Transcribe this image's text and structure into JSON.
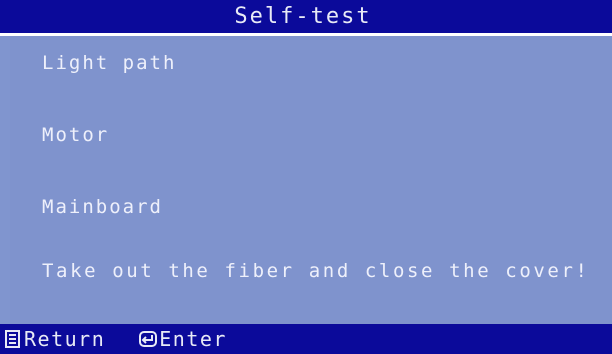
{
  "header": {
    "title": "Self-test"
  },
  "tests": [
    {
      "label": "Light path"
    },
    {
      "label": "Motor"
    },
    {
      "label": "Mainboard"
    }
  ],
  "message": "Take out the fiber and close the cover!",
  "footer": {
    "return": {
      "icon": "return-icon",
      "label": "Return"
    },
    "enter": {
      "icon": "enter-icon",
      "label": "Enter"
    }
  },
  "colors": {
    "bar_background": "#0b0a9a",
    "panel_background": "#7f93cd",
    "text": "#eef0fb"
  }
}
